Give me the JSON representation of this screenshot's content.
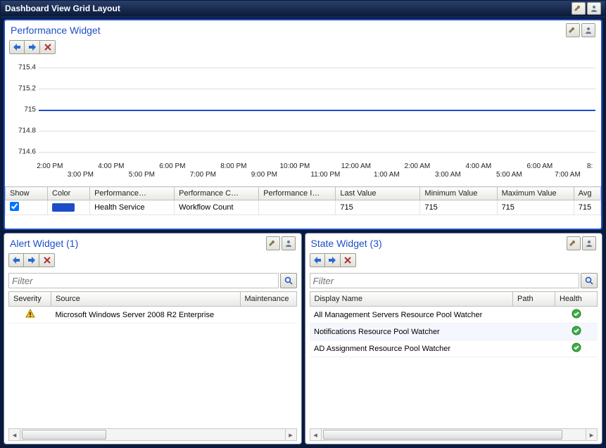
{
  "window": {
    "title": "Dashboard View Grid Layout"
  },
  "perf": {
    "title": "Performance Widget",
    "headers": {
      "show": "Show",
      "color": "Color",
      "obj": "Performance…",
      "counter": "Performance C…",
      "inst": "Performance I…",
      "last": "Last Value",
      "min": "Minimum Value",
      "max": "Maximum Value",
      "avg": "Avg"
    },
    "row": {
      "obj": "Health Service",
      "counter": "Workflow Count",
      "inst": "",
      "last": "715",
      "min": "715",
      "max": "715",
      "avg": "715"
    }
  },
  "alert": {
    "title": "Alert Widget (1)",
    "filter_placeholder": "Filter",
    "headers": {
      "severity": "Severity",
      "source": "Source",
      "maint": "Maintenance"
    },
    "rows": [
      {
        "source": "Microsoft Windows Server 2008 R2 Enterprise"
      }
    ]
  },
  "state": {
    "title": "State Widget (3)",
    "filter_placeholder": "Filter",
    "headers": {
      "name": "Display Name",
      "path": "Path",
      "health": "Health"
    },
    "rows": [
      {
        "name": "All Management Servers Resource Pool Watcher",
        "path": ""
      },
      {
        "name": "Notifications Resource Pool Watcher",
        "path": ""
      },
      {
        "name": "AD Assignment Resource Pool Watcher",
        "path": ""
      }
    ]
  },
  "chart_data": {
    "type": "line",
    "title": "Performance Widget",
    "ylabel": "",
    "xlabel": "",
    "ylim": [
      714.6,
      715.4
    ],
    "y_ticks": [
      "715.4",
      "715.2",
      "715",
      "714.8",
      "714.6"
    ],
    "x_ticks_top": [
      "2:00 PM",
      "4:00 PM",
      "6:00 PM",
      "8:00 PM",
      "10:00 PM",
      "12:00 AM",
      "2:00 AM",
      "4:00 AM",
      "6:00 AM",
      "8:"
    ],
    "x_ticks_bottom": [
      "3:00 PM",
      "5:00 PM",
      "7:00 PM",
      "9:00 PM",
      "11:00 PM",
      "1:00 AM",
      "3:00 AM",
      "5:00 AM",
      "7:00 AM"
    ],
    "series": [
      {
        "name": "Health Service — Workflow Count",
        "color": "#1e4ec7",
        "constant_value": 715
      }
    ]
  }
}
